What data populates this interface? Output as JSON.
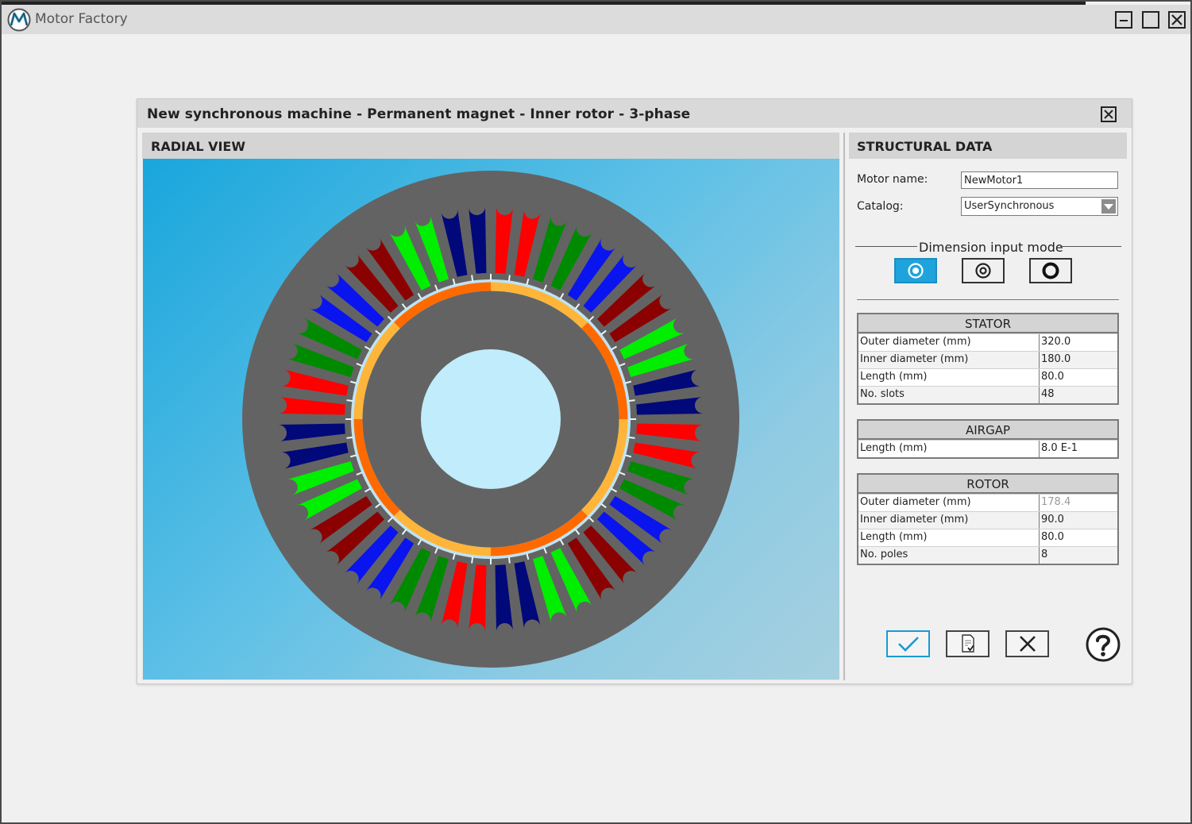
{
  "app": {
    "title": "Motor Factory",
    "icons": [
      "motor-factory-logo",
      "minimize-icon",
      "maximize-icon",
      "close-icon"
    ]
  },
  "dialog": {
    "title": "New synchronous machine - Permanent magnet - Inner rotor - 3-phase"
  },
  "radial_view": {
    "header": "RADIAL VIEW",
    "colors": {
      "background": "#19a6dc",
      "stator": "#636363",
      "shaft": "#c0ecfb",
      "phase_a": [
        "#ff0000",
        "#8b0000"
      ],
      "phase_b": [
        "#00ee00",
        "#008a00"
      ],
      "phase_c": [
        "#0a14ee",
        "#00087a"
      ],
      "magnet_north": "#ff6a00",
      "magnet_south": "#ffb53a"
    }
  },
  "structural": {
    "header": "STRUCTURAL DATA",
    "motor_name_label": "Motor name:",
    "motor_name": "NewMotor1",
    "catalog_label": "Catalog:",
    "catalog": "UserSynchronous",
    "dimension_mode_title": "Dimension input mode",
    "dimension_modes": [
      "dimension-mode-outer-icon",
      "dimension-mode-inner-icon",
      "dimension-mode-ring-icon"
    ],
    "stator": {
      "title": "STATOR",
      "rows": [
        {
          "label": "Outer diameter (mm)",
          "value": "320.0"
        },
        {
          "label": "Inner diameter (mm)",
          "value": "180.0"
        },
        {
          "label": "Length (mm)",
          "value": "80.0"
        },
        {
          "label": "No. slots",
          "value": "48"
        }
      ]
    },
    "airgap": {
      "title": "AIRGAP",
      "rows": [
        {
          "label": "Length (mm)",
          "value": "8.0 E-1"
        }
      ]
    },
    "rotor": {
      "title": "ROTOR",
      "rows": [
        {
          "label": "Outer diameter (mm)",
          "value": "178.4"
        },
        {
          "label": "Inner diameter (mm)",
          "value": "90.0"
        },
        {
          "label": "Length (mm)",
          "value": "80.0"
        },
        {
          "label": "No. poles",
          "value": "8"
        }
      ]
    },
    "actions": [
      "ok-check-icon",
      "save-document-icon",
      "cancel-x-icon",
      "help-question-icon"
    ]
  }
}
